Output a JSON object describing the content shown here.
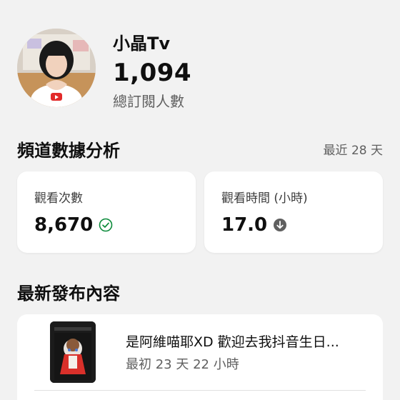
{
  "channel": {
    "name": "小晶Tv",
    "subscriber_count": "1,094",
    "subscriber_label": "總訂閱人數"
  },
  "analytics": {
    "title": "頻道數據分析",
    "period": "最近 28 天",
    "metrics": [
      {
        "label": "觀看次數",
        "value": "8,670",
        "status_icon": "check-circle-icon"
      },
      {
        "label": "觀看時間 (小時)",
        "value": "17.0",
        "status_icon": "arrow-down-circle-icon"
      }
    ]
  },
  "latest": {
    "title": "最新發布內容",
    "post": {
      "title": "是阿維喵耶XD 歡迎去我抖音生日...",
      "time": "最初 23 天 22 小時"
    }
  }
}
